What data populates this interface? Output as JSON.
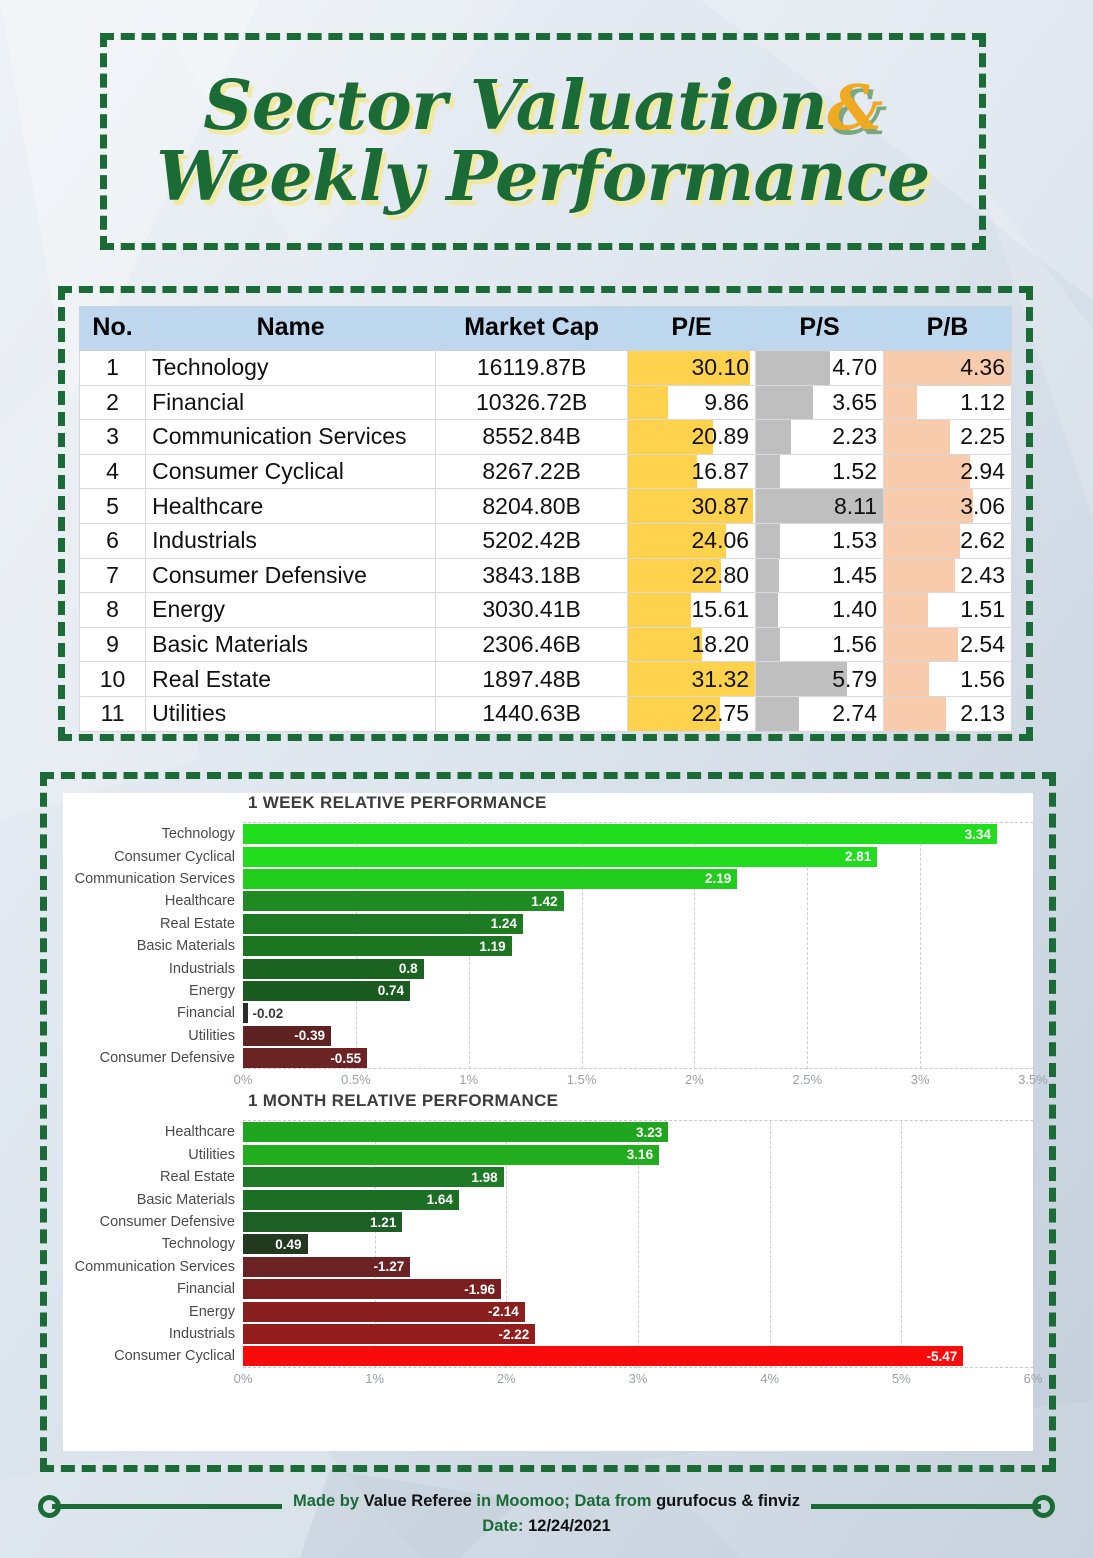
{
  "title": {
    "line1": "Sector Valuation",
    "amp": "&",
    "line2": "Weekly Performance"
  },
  "table": {
    "columns": [
      "No.",
      "Name",
      "Market Cap",
      "P/E",
      "P/S",
      "P/B"
    ],
    "bar_colors": {
      "pe": "#ffd24d",
      "ps": "#bfbfbf",
      "pb": "#f8cbad"
    },
    "max": {
      "pe": 31.32,
      "ps": 8.11,
      "pb": 4.36
    },
    "rows": [
      {
        "no": "1",
        "name": "Technology",
        "cap": "16119.87B",
        "pe": "30.10",
        "ps": "4.70",
        "pb": "4.36"
      },
      {
        "no": "2",
        "name": "Financial",
        "cap": "10326.72B",
        "pe": "9.86",
        "ps": "3.65",
        "pb": "1.12"
      },
      {
        "no": "3",
        "name": "Communication Services",
        "cap": "8552.84B",
        "pe": "20.89",
        "ps": "2.23",
        "pb": "2.25"
      },
      {
        "no": "4",
        "name": "Consumer Cyclical",
        "cap": "8267.22B",
        "pe": "16.87",
        "ps": "1.52",
        "pb": "2.94"
      },
      {
        "no": "5",
        "name": "Healthcare",
        "cap": "8204.80B",
        "pe": "30.87",
        "ps": "8.11",
        "pb": "3.06"
      },
      {
        "no": "6",
        "name": "Industrials",
        "cap": "5202.42B",
        "pe": "24.06",
        "ps": "1.53",
        "pb": "2.62"
      },
      {
        "no": "7",
        "name": "Consumer Defensive",
        "cap": "3843.18B",
        "pe": "22.80",
        "ps": "1.45",
        "pb": "2.43"
      },
      {
        "no": "8",
        "name": "Energy",
        "cap": "3030.41B",
        "pe": "15.61",
        "ps": "1.40",
        "pb": "1.51"
      },
      {
        "no": "9",
        "name": "Basic Materials",
        "cap": "2306.46B",
        "pe": "18.20",
        "ps": "1.56",
        "pb": "2.54"
      },
      {
        "no": "10",
        "name": "Real Estate",
        "cap": "1897.48B",
        "pe": "31.32",
        "ps": "5.79",
        "pb": "1.56"
      },
      {
        "no": "11",
        "name": "Utilities",
        "cap": "1440.63B",
        "pe": "22.75",
        "ps": "2.74",
        "pb": "2.13"
      }
    ]
  },
  "chart_data": [
    {
      "type": "bar",
      "orientation": "horizontal",
      "title": "1 WEEK RELATIVE PERFORMANCE",
      "xlabel": "",
      "ylabel": "",
      "xlim": [
        0,
        3.5
      ],
      "grid": true,
      "legend": "none",
      "tick_labels": [
        "0%",
        "0.5%",
        "1%",
        "1.5%",
        "2%",
        "2.5%",
        "3%",
        "3.5%"
      ],
      "ticks": [
        0,
        0.5,
        1,
        1.5,
        2,
        2.5,
        3,
        3.5
      ],
      "categories": [
        "Technology",
        "Consumer Cyclical",
        "Communication Services",
        "Healthcare",
        "Real Estate",
        "Basic Materials",
        "Industrials",
        "Energy",
        "Financial",
        "Utilities",
        "Consumer Defensive"
      ],
      "values": [
        3.34,
        2.81,
        2.19,
        1.42,
        1.24,
        1.19,
        0.8,
        0.74,
        -0.02,
        -0.39,
        -0.55
      ],
      "labels": [
        "3.34",
        "2.81",
        "2.19",
        "1.42",
        "1.24",
        "1.19",
        "0.8",
        "0.74",
        "-0.02",
        "-0.39",
        "-0.55"
      ],
      "colors": [
        "#22dd1e",
        "#22dd1e",
        "#22cc1c",
        "#1f8b22",
        "#1d7a22",
        "#1d7421",
        "#1b6321",
        "#1a5c20",
        "#2b2b2b",
        "#5e2222",
        "#6b2423"
      ]
    },
    {
      "type": "bar",
      "orientation": "horizontal",
      "title": "1 MONTH RELATIVE PERFORMANCE",
      "xlabel": "",
      "ylabel": "",
      "xlim": [
        0,
        6
      ],
      "grid": true,
      "legend": "none",
      "tick_labels": [
        "0%",
        "1%",
        "2%",
        "3%",
        "4%",
        "5%",
        "6%"
      ],
      "ticks": [
        0,
        1,
        2,
        3,
        4,
        5,
        6
      ],
      "categories": [
        "Healthcare",
        "Utilities",
        "Real Estate",
        "Basic Materials",
        "Consumer Defensive",
        "Technology",
        "Communication Services",
        "Financial",
        "Energy",
        "Industrials",
        "Consumer Cyclical"
      ],
      "values": [
        3.23,
        3.16,
        1.98,
        1.64,
        1.21,
        0.49,
        -1.27,
        -1.96,
        -2.14,
        -2.22,
        -5.47
      ],
      "labels": [
        "3.23",
        "3.16",
        "1.98",
        "1.64",
        "1.21",
        "0.49",
        "-1.27",
        "-1.96",
        "-2.14",
        "-2.22",
        "-5.47"
      ],
      "colors": [
        "#1fa51f",
        "#22ad1f",
        "#1e7a27",
        "#1d6e25",
        "#1e5f26",
        "#22391f",
        "#6b2222",
        "#7a1f1f",
        "#8a1f1f",
        "#941d1d",
        "#fa0a0a"
      ]
    }
  ],
  "footer": {
    "part1": "Made by ",
    "part2": "Value Referee",
    "part3": " in Moomoo; Data from ",
    "part4": "gurufocus & finviz",
    "date_label": "Date: ",
    "date_value": "12/24/2021"
  }
}
